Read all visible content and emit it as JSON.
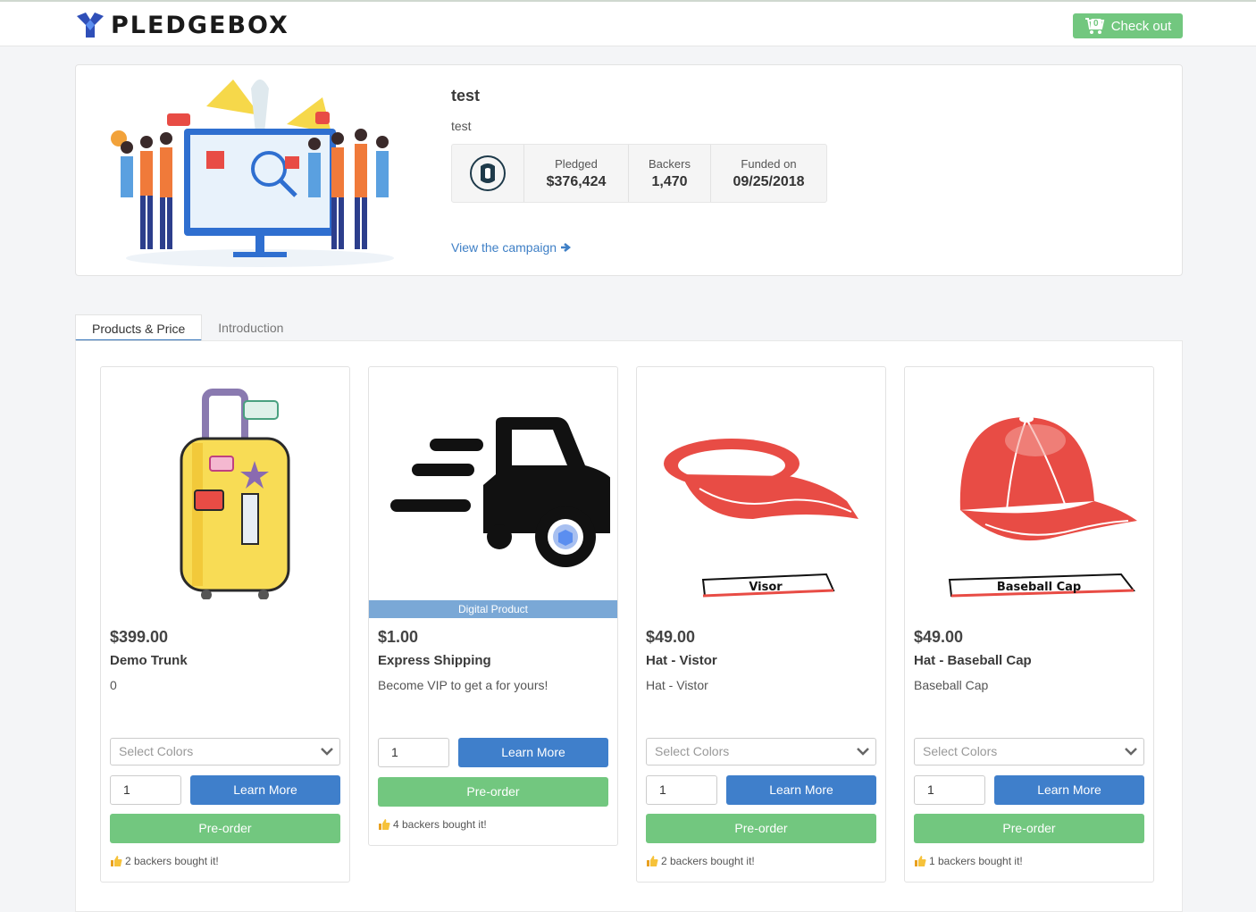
{
  "brand": {
    "name": "PLEDGEBOX"
  },
  "header": {
    "checkout_label": "Check out",
    "cart_count": "0"
  },
  "campaign": {
    "title": "test",
    "subtitle": "test",
    "stats": [
      {
        "label": "Pledged",
        "value": "$376,424"
      },
      {
        "label": "Backers",
        "value": "1,470"
      },
      {
        "label": "Funded on",
        "value": "09/25/2018"
      }
    ],
    "view_link": "View the campaign"
  },
  "tabs": [
    {
      "label": "Products & Price",
      "active": true
    },
    {
      "label": "Introduction",
      "active": false
    }
  ],
  "products": [
    {
      "price": "$399.00",
      "name": "Demo Trunk",
      "description": "0",
      "select_placeholder": "Select Colors",
      "qty": "1",
      "learn_label": "Learn More",
      "preorder_label": "Pre-order",
      "bought": "2 backers bought it!",
      "image_icon": "suitcase-icon"
    },
    {
      "price": "$1.00",
      "name": "Express Shipping",
      "description": "Become VIP to get a for yours!",
      "badge": "Digital Product",
      "qty": "1",
      "learn_label": "Learn More",
      "preorder_label": "Pre-order",
      "bought": "4 backers bought it!",
      "image_icon": "truck-icon"
    },
    {
      "price": "$49.00",
      "name": "Hat - Vistor",
      "description": "Hat - Vistor",
      "select_placeholder": "Select Colors",
      "qty": "1",
      "learn_label": "Learn More",
      "preorder_label": "Pre-order",
      "bought": "2 backers bought it!",
      "image_label": "Visor",
      "image_icon": "visor-icon"
    },
    {
      "price": "$49.00",
      "name": "Hat - Baseball Cap",
      "description": "Baseball Cap",
      "select_placeholder": "Select Colors",
      "qty": "1",
      "learn_label": "Learn More",
      "preorder_label": "Pre-order",
      "bought": "1 backers bought it!",
      "image_label": "Baseball Cap",
      "image_icon": "cap-icon"
    }
  ],
  "colors": {
    "primary": "#3f7fcb",
    "success": "#72c77f",
    "link": "#3e7fc6",
    "digital_badge": "#7aa8d6",
    "hat_red": "#e84c45"
  }
}
